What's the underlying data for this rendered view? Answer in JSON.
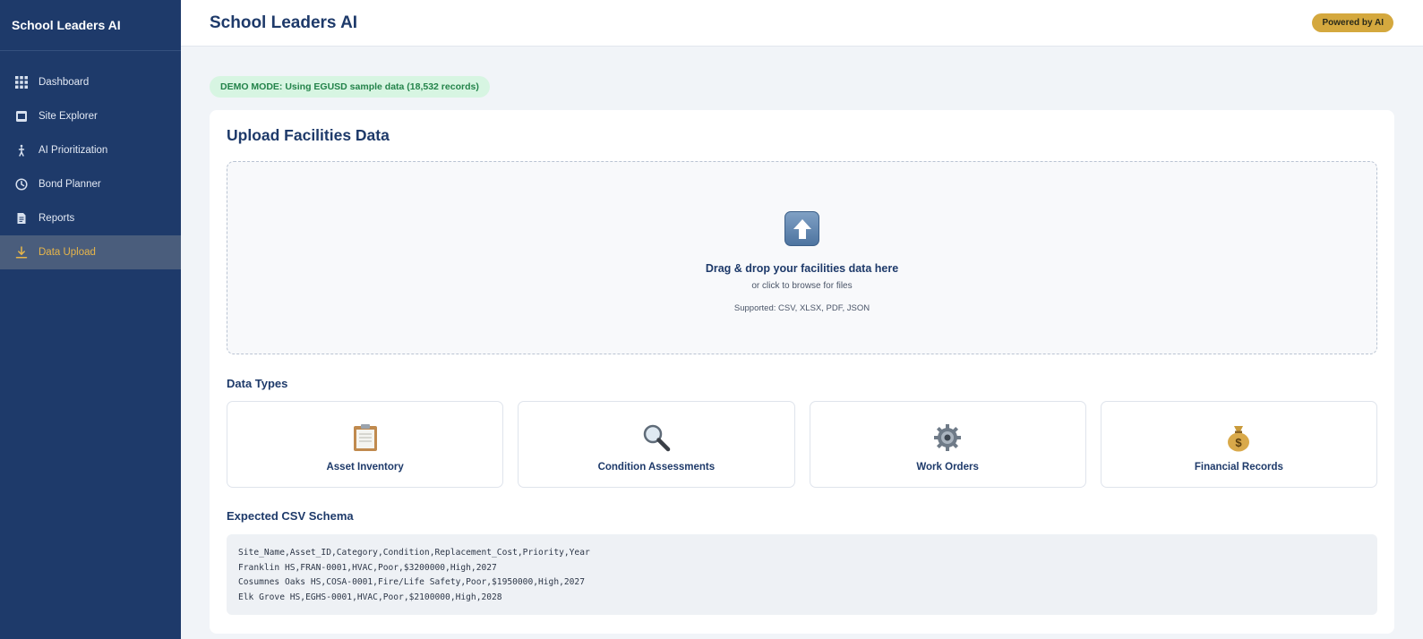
{
  "sidebar": {
    "brand": "School Leaders AI",
    "items": [
      {
        "label": "Dashboard",
        "icon": "grid-icon"
      },
      {
        "label": "Site Explorer",
        "icon": "building-icon"
      },
      {
        "label": "AI Prioritization",
        "icon": "person-walk-icon"
      },
      {
        "label": "Bond Planner",
        "icon": "clock-icon"
      },
      {
        "label": "Reports",
        "icon": "document-icon"
      },
      {
        "label": "Data Upload",
        "icon": "download-icon",
        "active": true
      }
    ]
  },
  "header": {
    "title": "School Leaders AI",
    "badge": "Powered by AI"
  },
  "demo_banner": "DEMO MODE: Using EGUSD sample data (18,532 records)",
  "upload": {
    "title": "Upload Facilities Data",
    "drop_title": "Drag & drop your facilities data here",
    "drop_sub": "or click to browse for files",
    "supported": "Supported: CSV, XLSX, PDF, JSON"
  },
  "data_types": {
    "title": "Data Types",
    "items": [
      {
        "label": "Asset Inventory",
        "icon": "clipboard-icon"
      },
      {
        "label": "Condition Assessments",
        "icon": "magnifier-icon"
      },
      {
        "label": "Work Orders",
        "icon": "gear-icon"
      },
      {
        "label": "Financial Records",
        "icon": "money-bag-icon"
      }
    ]
  },
  "schema": {
    "title": "Expected CSV Schema",
    "lines": [
      "Site_Name,Asset_ID,Category,Condition,Replacement_Cost,Priority,Year",
      "Franklin HS,FRAN-0001,HVAC,Poor,$3200000,High,2027",
      "Cosumnes Oaks HS,COSA-0001,Fire/Life Safety,Poor,$1950000,High,2027",
      "Elk Grove HS,EGHS-0001,HVAC,Poor,$2100000,High,2028"
    ]
  },
  "colors": {
    "sidebar": "#1e3a6a",
    "accent": "#d4a83e",
    "active_text": "#e8b64a",
    "demo_bg": "#d7f5e2",
    "demo_text": "#23834a"
  }
}
